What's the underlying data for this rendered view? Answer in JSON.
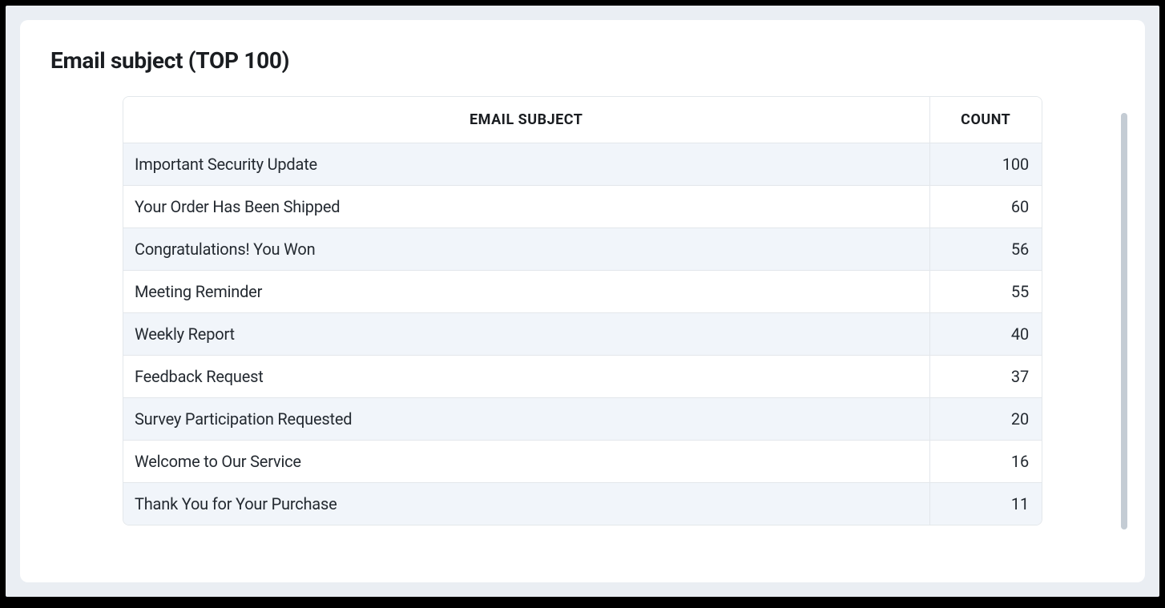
{
  "title": "Email subject (TOP 100)",
  "table": {
    "headers": {
      "subject": "EMAIL SUBJECT",
      "count": "COUNT"
    },
    "rows": [
      {
        "subject": "Important Security Update",
        "count": "100"
      },
      {
        "subject": "Your Order Has Been Shipped",
        "count": "60"
      },
      {
        "subject": "Congratulations! You Won",
        "count": "56"
      },
      {
        "subject": "Meeting Reminder",
        "count": "55"
      },
      {
        "subject": "Weekly Report",
        "count": "40"
      },
      {
        "subject": "Feedback Request",
        "count": "37"
      },
      {
        "subject": "Survey Participation Requested",
        "count": "20"
      },
      {
        "subject": "Welcome to Our Service",
        "count": "16"
      },
      {
        "subject": "Thank You for Your Purchase",
        "count": "11"
      }
    ]
  },
  "chart_data": {
    "type": "table",
    "title": "Email subject (TOP 100)",
    "columns": [
      "EMAIL SUBJECT",
      "COUNT"
    ],
    "rows": [
      [
        "Important Security Update",
        100
      ],
      [
        "Your Order Has Been Shipped",
        60
      ],
      [
        "Congratulations! You Won",
        56
      ],
      [
        "Meeting Reminder",
        55
      ],
      [
        "Weekly Report",
        40
      ],
      [
        "Feedback Request",
        37
      ],
      [
        "Survey Participation Requested",
        20
      ],
      [
        "Welcome to Our Service",
        16
      ],
      [
        "Thank You for Your Purchase",
        11
      ]
    ]
  }
}
